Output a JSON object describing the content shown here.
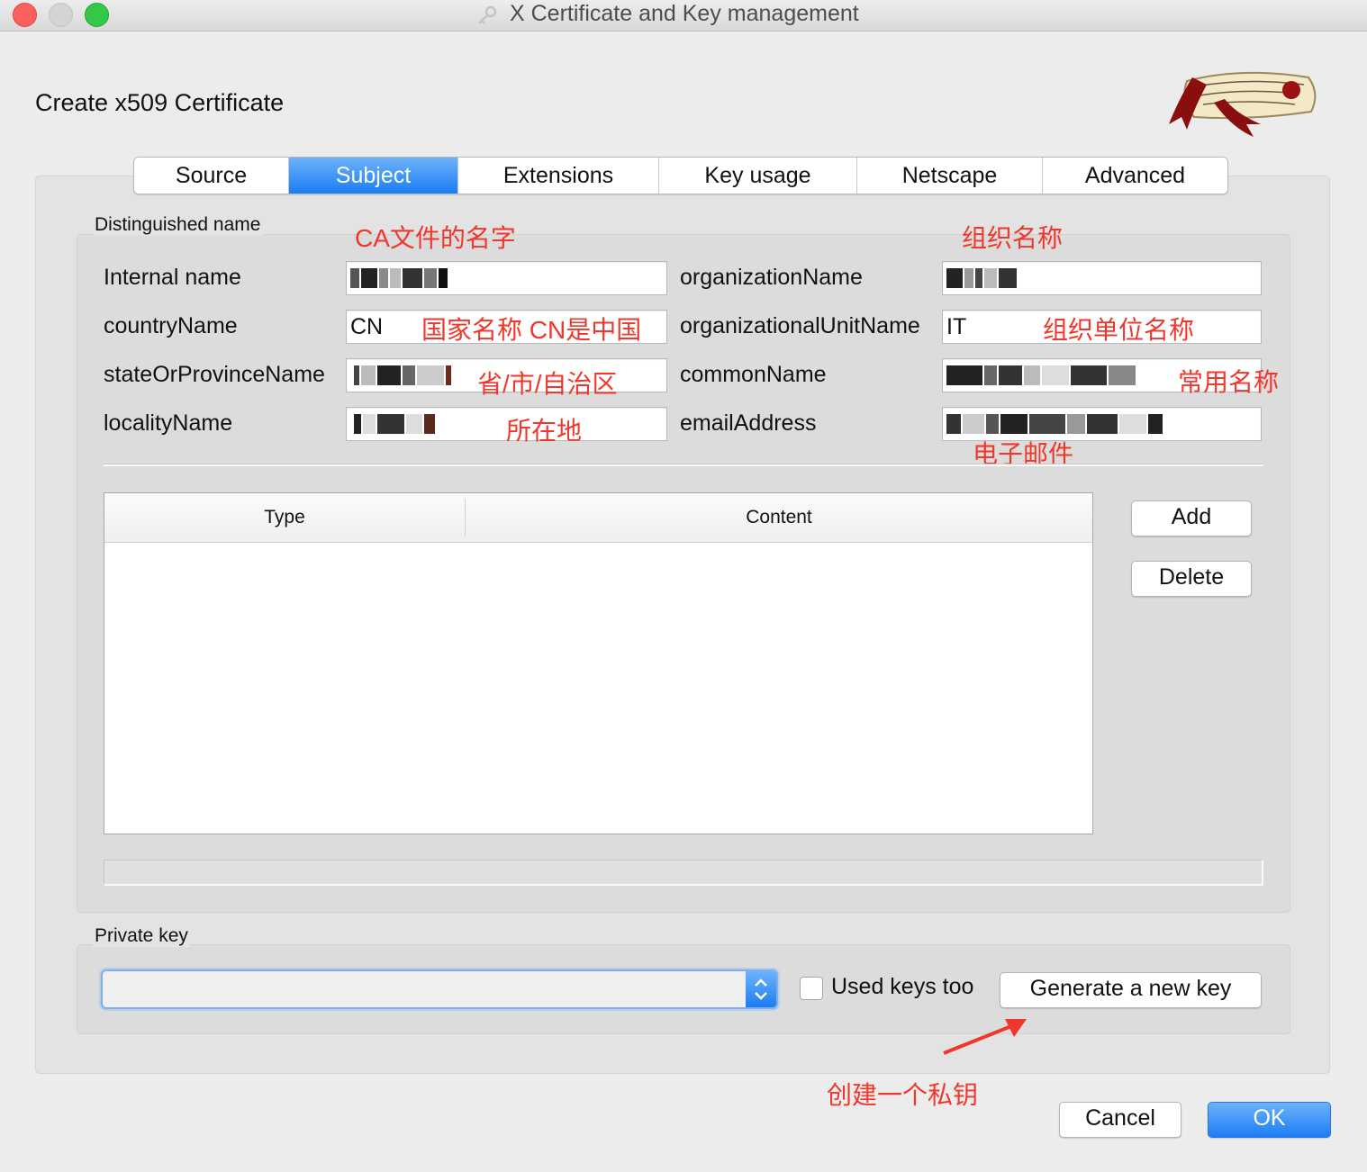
{
  "window": {
    "title": "X Certificate and Key management"
  },
  "dialog": {
    "heading": "Create x509 Certificate"
  },
  "tabs": [
    {
      "label": "Source",
      "active": false
    },
    {
      "label": "Subject",
      "active": true
    },
    {
      "label": "Extensions",
      "active": false
    },
    {
      "label": "Key usage",
      "active": false
    },
    {
      "label": "Netscape",
      "active": false
    },
    {
      "label": "Advanced",
      "active": false
    }
  ],
  "distinguished": {
    "group_title": "Distinguished name",
    "fields": {
      "internal_name": {
        "label": "Internal name",
        "value": ""
      },
      "country_name": {
        "label": "countryName",
        "value": "CN"
      },
      "state": {
        "label": "stateOrProvinceName",
        "value": ""
      },
      "locality": {
        "label": "localityName",
        "value": ""
      },
      "org_name": {
        "label": "organizationName",
        "value": ""
      },
      "org_unit": {
        "label": "organizationalUnitName",
        "value": "IT"
      },
      "common_name": {
        "label": "commonName",
        "value": ""
      },
      "email": {
        "label": "emailAddress",
        "value": ""
      }
    }
  },
  "annotations": {
    "internal_name": "CA文件的名字",
    "org_name": "组织名称",
    "country": "国家名称 CN是中国",
    "org_unit": "组织单位名称",
    "state": "省/市/自治区",
    "common_name": "常用名称",
    "locality": "所在地",
    "email": "电子邮件",
    "generate_key": "创建一个私钥",
    "color": "#f0372c"
  },
  "table": {
    "columns": [
      "Type",
      "Content"
    ],
    "rows": []
  },
  "buttons": {
    "add": "Add",
    "delete": "Delete",
    "generate_key": "Generate a new key",
    "cancel": "Cancel",
    "ok": "OK"
  },
  "private_key": {
    "group_title": "Private key",
    "selected": "",
    "used_keys_label": "Used keys too",
    "used_keys_checked": false
  },
  "colors": {
    "accent": "#1c7cf4",
    "window_bg": "#ececec"
  },
  "icons": {
    "window_icon": "key-icon",
    "logo": "certificate-scroll-logo",
    "select_arrows": "up-down-arrows-icon",
    "annotation_arrow": "red-arrow-icon"
  }
}
